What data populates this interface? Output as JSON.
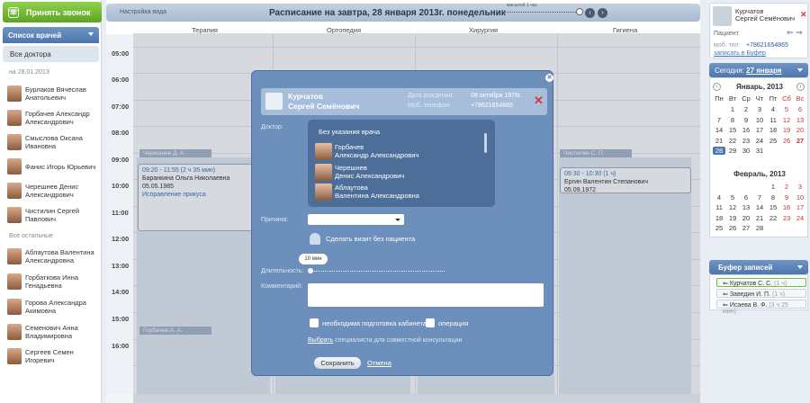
{
  "left": {
    "call_button": "Принять звонок",
    "doctor_list_title": "Список врачей",
    "all_doctors": "Все доктора",
    "date_label": "на 28.01.2013",
    "doctors": [
      {
        "l1": "Бурлаков Вячеслав",
        "l2": "Анатольевич"
      },
      {
        "l1": "Горбачев Александр",
        "l2": "Александрович"
      },
      {
        "l1": "Смыслова Оксана",
        "l2": "Ивановна"
      },
      {
        "l1": "Фанис Игорь Юрьевич",
        "l2": ""
      },
      {
        "l1": "Черешнев Денис",
        "l2": "Александрович"
      },
      {
        "l1": "Чистилин Сергей",
        "l2": "Павлович"
      }
    ],
    "others_label": "Все остальные",
    "others": [
      {
        "l1": "Аблаутова Валентина",
        "l2": "Александровна"
      },
      {
        "l1": "Горбаткова Инна",
        "l2": "Генадьевна"
      },
      {
        "l1": "Горова Александра",
        "l2": "Акимовна"
      },
      {
        "l1": "Семенович Анна",
        "l2": "Владимировна"
      },
      {
        "l1": "Сергеев Семен",
        "l2": "Игоревич"
      }
    ]
  },
  "header": {
    "view_settings": "Настройка вида",
    "title": "Расписание на завтра, 28 января 2013г. понедельник",
    "prev": "‹",
    "next": "›",
    "zoom_labels": "масштаб 1 час"
  },
  "columns": [
    "Терапия",
    "Ортопедия",
    "Хирургия",
    "Гигиена"
  ],
  "times": [
    "05:00",
    "06:00",
    "07:00",
    "08:00",
    "09:00",
    "10:00",
    "11:00",
    "12:00",
    "13:00",
    "14:00",
    "15:00",
    "16:00"
  ],
  "schedule": {
    "cheresh_bar": "Черешнев Д. А.",
    "gorbachev_bar": "Горбачев А. А.",
    "chistilin_bar": "Чистилин С. П.",
    "appt1": {
      "time": "09:20 - 11:55 (2 ч 35 мин)",
      "name": "Баранкина Ольга Николаевна",
      "dob": "05.05.1985",
      "note": "Исправление прикуса"
    },
    "appt2": {
      "time": "09:30 - 10:30 (1 ч)",
      "name": "Ергин Валентин Степанович",
      "dob": "05.09.1972"
    }
  },
  "right": {
    "patient_name_l1": "Курчатов",
    "patient_name_l2": "Сергей Семёнович",
    "patient_label": "Пациент",
    "phone_label": "моб. тел:",
    "phone": "+78621654865",
    "to_buffer": "записать в Буфер",
    "today_prefix": "Сегодня:",
    "today_date": "27 января",
    "cal1": {
      "month": "Январь, 2013",
      "dow": [
        "Пн",
        "Вт",
        "Ср",
        "Чт",
        "Пт",
        "Сб",
        "Вс"
      ],
      "days": [
        "",
        "1",
        "2",
        "3",
        "4",
        "5",
        "6",
        "7",
        "8",
        "9",
        "10",
        "11",
        "12",
        "13",
        "14",
        "15",
        "16",
        "17",
        "18",
        "19",
        "20",
        "21",
        "22",
        "23",
        "24",
        "25",
        "26",
        "27",
        "28",
        "29",
        "30",
        "31"
      ]
    },
    "cal2": {
      "month": "Февраль, 2013",
      "days": [
        "",
        "",
        "",
        "",
        "1",
        "2",
        "3",
        "4",
        "5",
        "6",
        "7",
        "8",
        "9",
        "10",
        "11",
        "12",
        "13",
        "14",
        "15",
        "16",
        "17",
        "18",
        "19",
        "20",
        "21",
        "22",
        "23",
        "24",
        "25",
        "26",
        "27",
        "28"
      ]
    },
    "buffer_title": "Буфер записей",
    "buffer_items": [
      {
        "name": "Курчатов С. С.",
        "dur": "(1 ч)"
      },
      {
        "name": "Заведин И. П.",
        "dur": "(1 ч)"
      },
      {
        "name": "Исаева В. Ф.",
        "dur": "(3 ч 25 мин)"
      }
    ]
  },
  "modal": {
    "patient_l1": "Курчатов",
    "patient_l2": "Сергей Семёнович",
    "dob_label": "Дата рождения:",
    "dob": "08 октября 1976г.",
    "phone_label": "Моб. телефон:",
    "phone": "+78621654865",
    "doctor_label": "Доктор:",
    "no_doctor": "Без указания врача",
    "picker": [
      {
        "l1": "Горбачев",
        "l2": "Александр Александрович"
      },
      {
        "l1": "Черешнев",
        "l2": "Денис Александрович"
      },
      {
        "l1": "Аблаутова",
        "l2": "Валентина Александровна"
      }
    ],
    "reason_label": "Причина:",
    "no_patient": "Сделать визит без пациента",
    "duration_value": "10 мин",
    "duration_label": "Длительность:",
    "comment_label": "Комментарий:",
    "chk1": "необходима подготовка кабинета",
    "chk2": "операция",
    "consult_link": "Выбрать",
    "consult_rest": " специалиста для совместной консультации",
    "save": "Сохранить",
    "cancel": "Отмена"
  }
}
